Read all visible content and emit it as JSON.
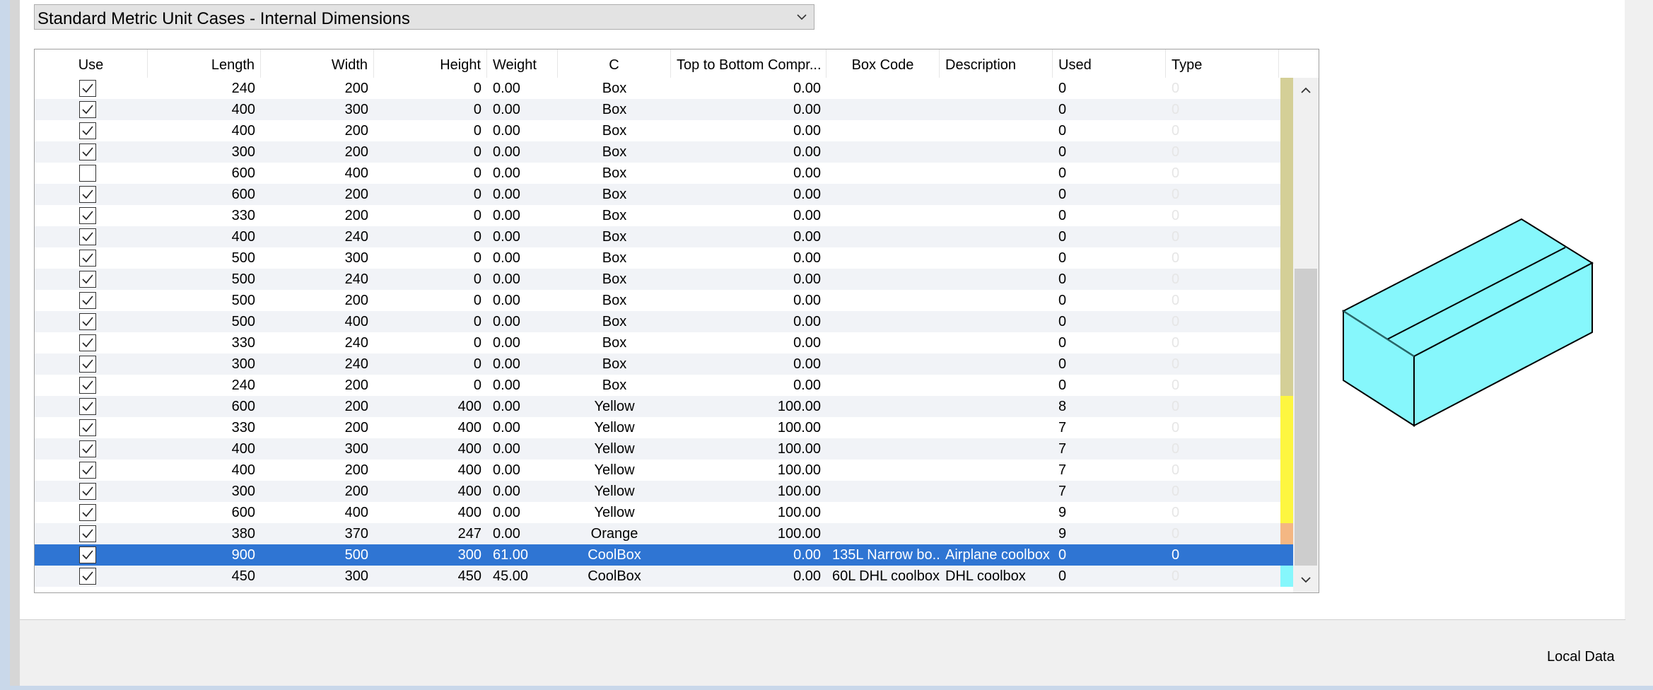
{
  "dropdown": {
    "selected": "Standard Metric Unit Cases - Internal Dimensions"
  },
  "columns": [
    "Use",
    "Length",
    "Width",
    "Height",
    "Weight",
    "C",
    "Top to Bottom Compr...",
    "Box Code",
    "Description",
    "Used",
    "Type"
  ],
  "rows": [
    {
      "use": true,
      "length": "240",
      "width": "200",
      "height": "0",
      "weight": "0.00",
      "c": "Box",
      "ttb": "0.00",
      "boxcode": "",
      "description": "",
      "used": "0",
      "type": "0",
      "color": "#d4cf97"
    },
    {
      "use": true,
      "length": "400",
      "width": "300",
      "height": "0",
      "weight": "0.00",
      "c": "Box",
      "ttb": "0.00",
      "boxcode": "",
      "description": "",
      "used": "0",
      "type": "0",
      "color": "#d4cf97"
    },
    {
      "use": true,
      "length": "400",
      "width": "200",
      "height": "0",
      "weight": "0.00",
      "c": "Box",
      "ttb": "0.00",
      "boxcode": "",
      "description": "",
      "used": "0",
      "type": "0",
      "color": "#d4cf97"
    },
    {
      "use": true,
      "length": "300",
      "width": "200",
      "height": "0",
      "weight": "0.00",
      "c": "Box",
      "ttb": "0.00",
      "boxcode": "",
      "description": "",
      "used": "0",
      "type": "0",
      "color": "#d4cf97"
    },
    {
      "use": false,
      "length": "600",
      "width": "400",
      "height": "0",
      "weight": "0.00",
      "c": "Box",
      "ttb": "0.00",
      "boxcode": "",
      "description": "",
      "used": "0",
      "type": "0",
      "color": "#d4cf97"
    },
    {
      "use": true,
      "length": "600",
      "width": "200",
      "height": "0",
      "weight": "0.00",
      "c": "Box",
      "ttb": "0.00",
      "boxcode": "",
      "description": "",
      "used": "0",
      "type": "0",
      "color": "#d4cf97"
    },
    {
      "use": true,
      "length": "330",
      "width": "200",
      "height": "0",
      "weight": "0.00",
      "c": "Box",
      "ttb": "0.00",
      "boxcode": "",
      "description": "",
      "used": "0",
      "type": "0",
      "color": "#d4cf97"
    },
    {
      "use": true,
      "length": "400",
      "width": "240",
      "height": "0",
      "weight": "0.00",
      "c": "Box",
      "ttb": "0.00",
      "boxcode": "",
      "description": "",
      "used": "0",
      "type": "0",
      "color": "#d4cf97"
    },
    {
      "use": true,
      "length": "500",
      "width": "300",
      "height": "0",
      "weight": "0.00",
      "c": "Box",
      "ttb": "0.00",
      "boxcode": "",
      "description": "",
      "used": "0",
      "type": "0",
      "color": "#d4cf97"
    },
    {
      "use": true,
      "length": "500",
      "width": "240",
      "height": "0",
      "weight": "0.00",
      "c": "Box",
      "ttb": "0.00",
      "boxcode": "",
      "description": "",
      "used": "0",
      "type": "0",
      "color": "#d4cf97"
    },
    {
      "use": true,
      "length": "500",
      "width": "200",
      "height": "0",
      "weight": "0.00",
      "c": "Box",
      "ttb": "0.00",
      "boxcode": "",
      "description": "",
      "used": "0",
      "type": "0",
      "color": "#d4cf97"
    },
    {
      "use": true,
      "length": "500",
      "width": "400",
      "height": "0",
      "weight": "0.00",
      "c": "Box",
      "ttb": "0.00",
      "boxcode": "",
      "description": "",
      "used": "0",
      "type": "0",
      "color": "#d4cf97"
    },
    {
      "use": true,
      "length": "330",
      "width": "240",
      "height": "0",
      "weight": "0.00",
      "c": "Box",
      "ttb": "0.00",
      "boxcode": "",
      "description": "",
      "used": "0",
      "type": "0",
      "color": "#d4cf97"
    },
    {
      "use": true,
      "length": "300",
      "width": "240",
      "height": "0",
      "weight": "0.00",
      "c": "Box",
      "ttb": "0.00",
      "boxcode": "",
      "description": "",
      "used": "0",
      "type": "0",
      "color": "#d4cf97"
    },
    {
      "use": true,
      "length": "240",
      "width": "200",
      "height": "0",
      "weight": "0.00",
      "c": "Box",
      "ttb": "0.00",
      "boxcode": "",
      "description": "",
      "used": "0",
      "type": "0",
      "color": "#d4cf97"
    },
    {
      "use": true,
      "length": "600",
      "width": "200",
      "height": "400",
      "weight": "0.00",
      "c": "Yellow",
      "ttb": "100.00",
      "boxcode": "",
      "description": "",
      "used": "8",
      "type": "0",
      "color": "#fdf640"
    },
    {
      "use": true,
      "length": "330",
      "width": "200",
      "height": "400",
      "weight": "0.00",
      "c": "Yellow",
      "ttb": "100.00",
      "boxcode": "",
      "description": "",
      "used": "7",
      "type": "0",
      "color": "#fdf640"
    },
    {
      "use": true,
      "length": "400",
      "width": "300",
      "height": "400",
      "weight": "0.00",
      "c": "Yellow",
      "ttb": "100.00",
      "boxcode": "",
      "description": "",
      "used": "7",
      "type": "0",
      "color": "#fdf640"
    },
    {
      "use": true,
      "length": "400",
      "width": "200",
      "height": "400",
      "weight": "0.00",
      "c": "Yellow",
      "ttb": "100.00",
      "boxcode": "",
      "description": "",
      "used": "7",
      "type": "0",
      "color": "#fdf640"
    },
    {
      "use": true,
      "length": "300",
      "width": "200",
      "height": "400",
      "weight": "0.00",
      "c": "Yellow",
      "ttb": "100.00",
      "boxcode": "",
      "description": "",
      "used": "7",
      "type": "0",
      "color": "#fdf640"
    },
    {
      "use": true,
      "length": "600",
      "width": "400",
      "height": "400",
      "weight": "0.00",
      "c": "Yellow",
      "ttb": "100.00",
      "boxcode": "",
      "description": "",
      "used": "9",
      "type": "0",
      "color": "#fdf640"
    },
    {
      "use": true,
      "length": "380",
      "width": "370",
      "height": "247",
      "weight": "0.00",
      "c": "Orange",
      "ttb": "100.00",
      "boxcode": "",
      "description": "",
      "used": "9",
      "type": "0",
      "color": "#f4b783"
    },
    {
      "use": true,
      "length": "900",
      "width": "500",
      "height": "300",
      "weight": "61.00",
      "c": "CoolBox",
      "ttb": "0.00",
      "boxcode": "135L Narrow bo...",
      "description": "Airplane coolbox",
      "used": "0",
      "type": "0",
      "color": "#2f75d3",
      "selected": true
    },
    {
      "use": true,
      "length": "450",
      "width": "300",
      "height": "450",
      "weight": "45.00",
      "c": "CoolBox",
      "ttb": "0.00",
      "boxcode": "60L DHL coolbox",
      "description": "DHL coolbox",
      "used": "0",
      "type": "0",
      "color": "#86f7fc"
    }
  ],
  "status": {
    "text": "Local Data"
  },
  "colors": {
    "selection": "#2f75d3",
    "box_preview": "#86f7fc"
  }
}
